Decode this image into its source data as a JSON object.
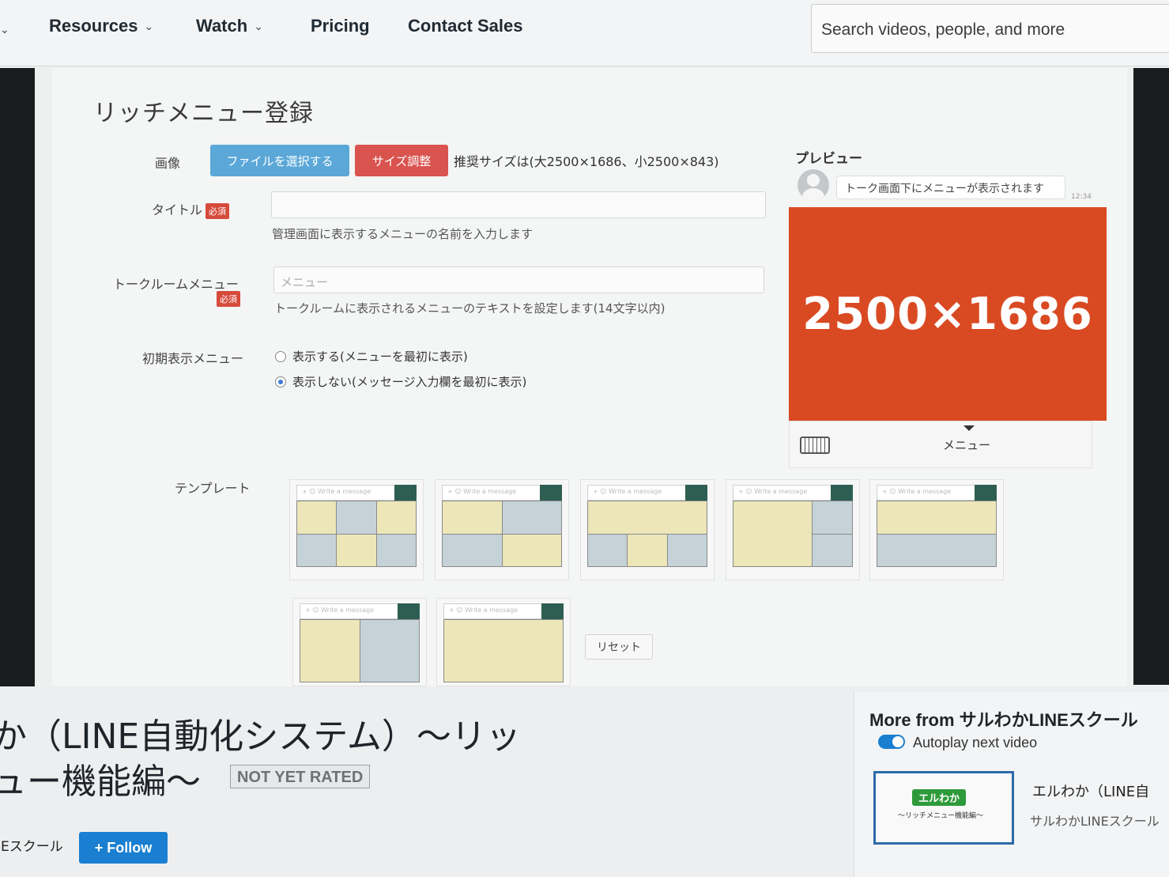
{
  "nav": {
    "items": [
      {
        "label": "Resources",
        "has_dropdown": true
      },
      {
        "label": "Watch",
        "has_dropdown": true
      },
      {
        "label": "Pricing",
        "has_dropdown": false
      },
      {
        "label": "Contact Sales",
        "has_dropdown": false
      }
    ],
    "search_placeholder": "Search videos, people, and more"
  },
  "form": {
    "title": "リッチメニュー登録",
    "image_label": "画像",
    "file_button": "ファイルを選択する",
    "size_button": "サイズ調整",
    "size_note": "推奨サイズは(大2500×1686、小2500×843)",
    "title_label": "タイトル",
    "required_badge": "必須",
    "title_help": "管理画面に表示するメニューの名前を入力します",
    "talk_label": "トークルームメニュー",
    "talk_placeholder": "メニュー",
    "talk_help": "トークルームに表示されるメニューのテキストを設定します(14文字以内)",
    "initial_label": "初期表示メニュー",
    "radio_options": [
      {
        "label": "表示する(メニューを最初に表示)",
        "selected": false
      },
      {
        "label": "表示しない(メッセージ入力欄を最初に表示)",
        "selected": true
      }
    ],
    "template_label": "テンプレート",
    "reset_button": "リセット"
  },
  "preview": {
    "label": "プレビュー",
    "bubble": "トーク画面下にメニューが表示されます",
    "time": "12:34",
    "image_text": "2500×1686",
    "menu_label": "メニュー",
    "accent": "#d94a23"
  },
  "video": {
    "title_line1": "か（LINE自動化システム）〜リッ",
    "title_line2": "ュー機能編〜",
    "rating": "NOT YET RATED",
    "channel": "IEスクール",
    "follow": "+ Follow"
  },
  "sidebar": {
    "more_from": "More from サルわかLINEスクール",
    "autoplay": "Autoplay next video",
    "thumb_logo": "エルわか",
    "thumb_sub": "〜リッチメニュー機能編〜",
    "related_title": "エルわか（LINE自",
    "related_channel": "サルわかLINEスクール"
  }
}
